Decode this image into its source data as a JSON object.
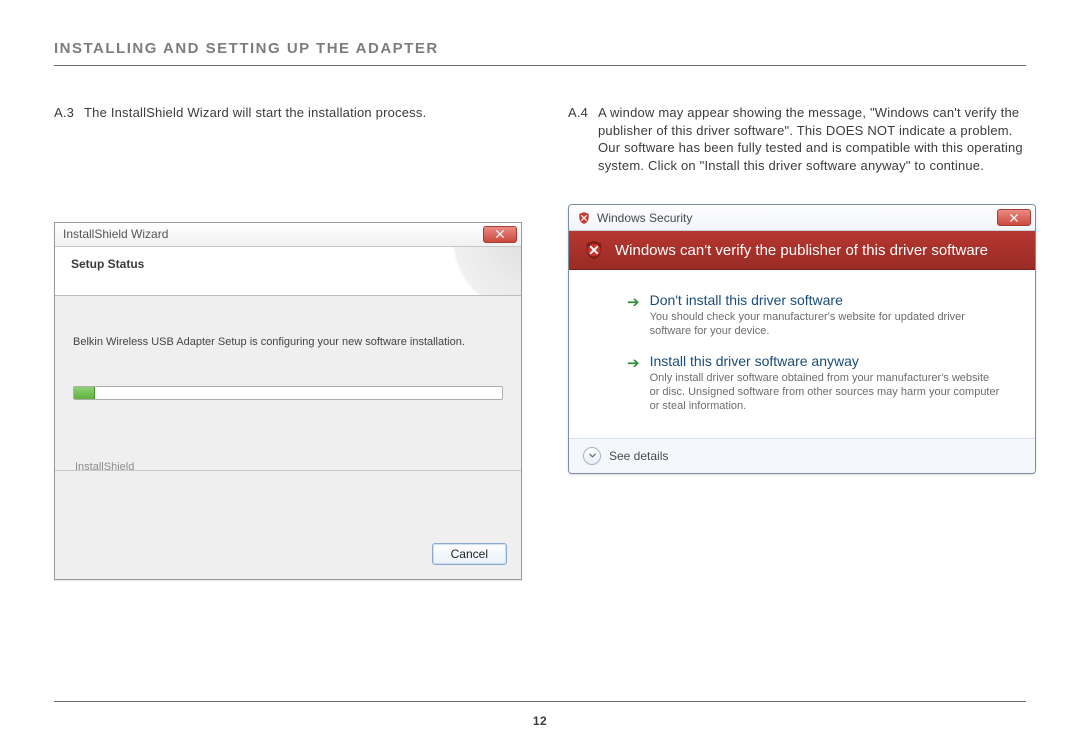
{
  "section_title": "INSTALLING AND SETTING UP THE ADAPTER",
  "left": {
    "step_num": "A.3",
    "step_text": "The InstallShield Wizard will start the installation process.",
    "wizard": {
      "window_title": "InstallShield Wizard",
      "heading": "Setup Status",
      "message": "Belkin Wireless USB Adapter Setup is configuring your new software installation.",
      "brand": "InstallShield",
      "cancel_label": "Cancel"
    }
  },
  "right": {
    "step_num": "A.4",
    "step_text": "A window may appear showing the message, \"Windows can't verify the publisher of this driver software\". This DOES NOT indicate a problem. Our software has been fully tested and is compatible with this operating system. Click on \"Install this driver software anyway\" to continue.",
    "security": {
      "window_title": "Windows Security",
      "banner": "Windows can't verify the publisher of this driver software",
      "option1_headline": "Don't install this driver software",
      "option1_desc": "You should check your manufacturer's website for updated driver software for your device.",
      "option2_headline": "Install this driver software anyway",
      "option2_desc": "Only install driver software obtained from your manufacturer's website or disc. Unsigned software from other sources may harm your computer or steal information.",
      "see_details": "See details"
    }
  },
  "page_number": "12"
}
